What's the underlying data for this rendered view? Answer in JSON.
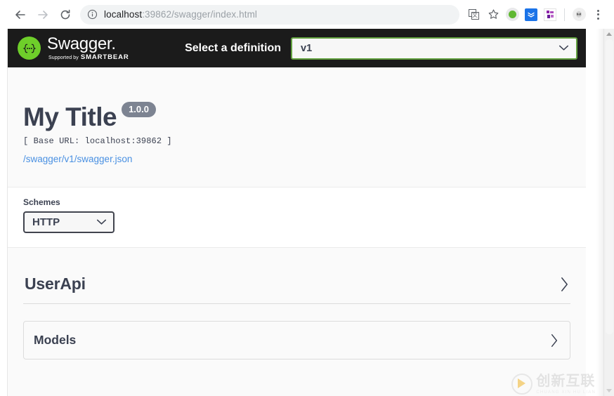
{
  "browser": {
    "back_label": "Back",
    "forward_label": "Forward",
    "reload_label": "Reload",
    "url_host": "localhost",
    "url_rest": ":39862/swagger/index.html",
    "site_info_icon": "info-circle-icon",
    "bookmark_icon": "star-icon",
    "menu_icon": "kebab-menu-icon",
    "extensions": [
      {
        "name": "translate-extension-icon",
        "label": ""
      },
      {
        "name": "green-dot-extension-icon",
        "label": ""
      },
      {
        "name": "blue-download-extension-icon",
        "label": ""
      },
      {
        "name": "purple-puzzle-extension-icon",
        "label": ""
      },
      {
        "name": "alien-profile-icon",
        "label": ""
      }
    ]
  },
  "topbar": {
    "logo_glyph": "{...}",
    "product_name": "Swagger",
    "product_dot": ".",
    "supported_by": "Supported by",
    "brand": "SMARTBEAR",
    "definition_label": "Select a definition",
    "definition_value": "v1",
    "definition_options": [
      "v1"
    ],
    "chevron_icon": "chevron-down-icon",
    "accent_green": "#62a03f",
    "logo_green": "#6ece2a",
    "bar_background": "#1b1b1b"
  },
  "info": {
    "title": "My Title",
    "version": "1.0.0",
    "base_url": "[ Base URL: localhost:39862 ]",
    "spec_link": "/swagger/v1/swagger.json",
    "link_color": "#4990e2",
    "badge_color": "#7d8492"
  },
  "schemes": {
    "label": "Schemes",
    "value": "HTTP",
    "options": [
      "HTTP"
    ],
    "chevron_icon": "chevron-down-icon"
  },
  "sections": {
    "tags": [
      {
        "name": "UserApi",
        "expand_icon": "chevron-right-icon"
      }
    ],
    "models": {
      "name": "Models",
      "expand_icon": "chevron-right-icon"
    }
  },
  "watermark": {
    "cn_text": "创新互联",
    "en_text": "CHUANG XIN HU LIAN"
  },
  "scrollbar": {
    "up_icon": "scroll-up-arrow-icon",
    "down_icon": "scroll-down-arrow-icon"
  }
}
